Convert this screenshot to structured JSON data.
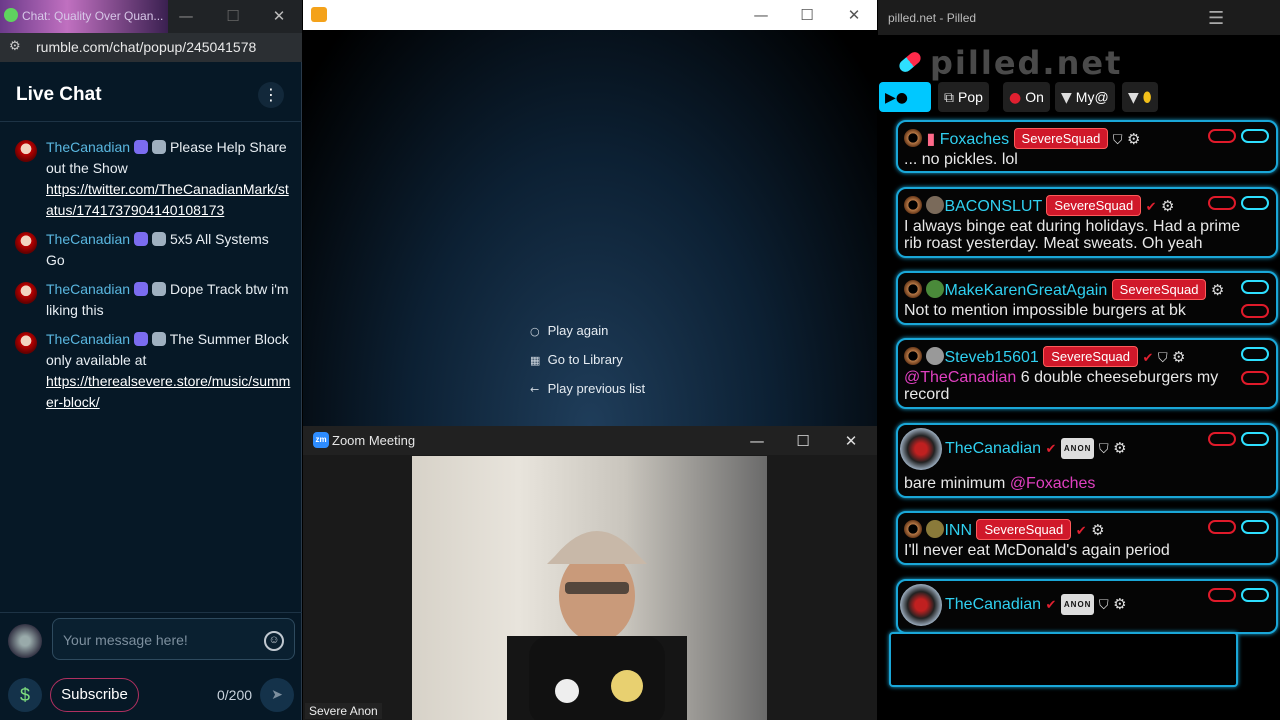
{
  "rumble": {
    "tab_title": "Chat: Quality Over Quan...",
    "url": "rumble.com/chat/popup/245041578",
    "header_title": "Live Chat",
    "menu_glyph": "⋮",
    "messages": [
      {
        "user": "TheCanadian",
        "text": "Please Help Share out the Show",
        "link": "https://twitter.com/TheCanadianMark/status/1741737904140108173"
      },
      {
        "user": "TheCanadian",
        "text": "5x5 All Systems Go"
      },
      {
        "user": "TheCanadian",
        "text": "Dope Track btw i'm liking this"
      },
      {
        "user": "TheCanadian",
        "text": "The Summer Block only available at",
        "link": "https://therealsevere.store/music/summer-block/"
      }
    ],
    "input_placeholder": "Your message here!",
    "subscribe_label": "Subscribe",
    "char_count": "0/200",
    "dollar_glyph": "$",
    "send_glyph": "➤",
    "emoji_glyph": "☺"
  },
  "player": {
    "options": [
      {
        "icon": "○",
        "label": "Play again"
      },
      {
        "icon": "▦",
        "label": "Go to Library"
      },
      {
        "icon": "←",
        "label": "Play previous list"
      }
    ]
  },
  "zoom": {
    "icon_text": "zm",
    "title": "Zoom Meeting",
    "participant_label": "Severe Anon"
  },
  "window_controls": {
    "minimize": "—",
    "maximize": "☐",
    "close": "✕"
  },
  "pilled": {
    "window_title": "pilled.net - Pilled",
    "logo": "pilled.net",
    "hamburger": "☰",
    "toolbar": [
      {
        "icon": "⧉",
        "label": "Pop"
      },
      {
        "icon": "●",
        "label": "On"
      },
      {
        "icon": "▼",
        "label": "My@"
      },
      {
        "icon": "▼",
        "label": ""
      }
    ],
    "badge_label": "SevereSquad",
    "anon_badge": "ANON",
    "messages": [
      {
        "user": "Foxaches",
        "text": "... no pickles. lol"
      },
      {
        "user": "BACONSLUT",
        "text1": "I always binge eat during holidays. Had a prime",
        "text2": "rib roast yesterday. Meat sweats. Oh yeah"
      },
      {
        "user": "MakeKarenGreatAgain",
        "text": "Not to mention impossible burgers at bk"
      },
      {
        "user": "Steveb15601",
        "mention": "@TheCanadian",
        "text1": " 6 double cheeseburgers my",
        "text2": "record"
      },
      {
        "user": "TheCanadian",
        "text": "bare minimum ",
        "mention": "@Foxaches"
      },
      {
        "user": "INN",
        "text": "I'll never eat McDonald's again period"
      },
      {
        "user": "TheCanadian"
      }
    ]
  }
}
